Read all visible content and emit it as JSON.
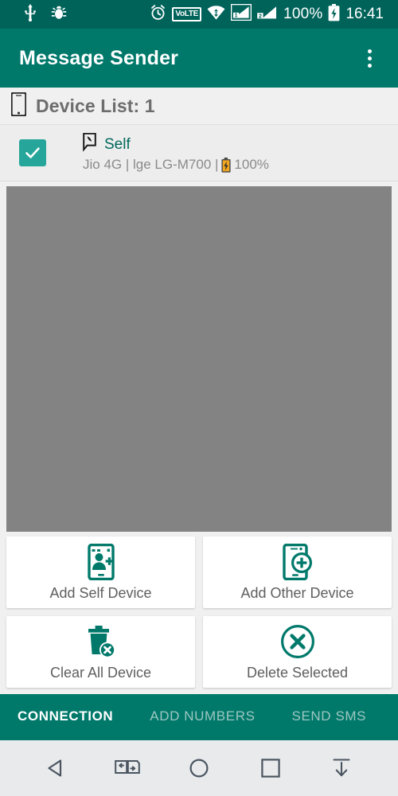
{
  "status_bar": {
    "left_icons": [
      "usb-icon",
      "bug-icon"
    ],
    "alarm_icon": "alarm-clock-icon",
    "volte_label": "VoLTE",
    "wifi_icon": "wifi-icon",
    "sim1_label": "1",
    "sim2_label": "2",
    "battery_percent": "100%",
    "battery_icon": "battery-charging-icon",
    "time": "16:41"
  },
  "toolbar": {
    "title": "Message Sender",
    "overflow_menu": "more-options"
  },
  "device_list": {
    "header_label": "Device List: 1",
    "header_icon": "smartphone-icon",
    "items": [
      {
        "checked": true,
        "icon": "phone-message-icon",
        "name": "Self",
        "details": "Jio 4G | lge LG-M700 |",
        "battery": "100%"
      }
    ]
  },
  "actions": [
    {
      "label": "Add Self Device",
      "icon": "add-self-device-icon"
    },
    {
      "label": "Add Other Device",
      "icon": "add-other-device-icon"
    },
    {
      "label": "Clear All Device",
      "icon": "trash-delete-icon"
    },
    {
      "label": "Delete Selected",
      "icon": "circle-x-icon"
    }
  ],
  "tabs": [
    {
      "label": "CONNECTION",
      "active": true
    },
    {
      "label": "ADD NUMBERS",
      "active": false
    },
    {
      "label": "SEND SMS",
      "active": false
    }
  ],
  "nav_bar": {
    "back": "back-icon",
    "multiwindow": "multi-window-icon",
    "home": "home-icon",
    "recents": "recents-icon",
    "hide": "hide-navbar-icon"
  },
  "colors": {
    "primary": "#00796b",
    "primary_dark": "#00635a",
    "accent": "#26a69a",
    "panel_gray": "#838383"
  }
}
